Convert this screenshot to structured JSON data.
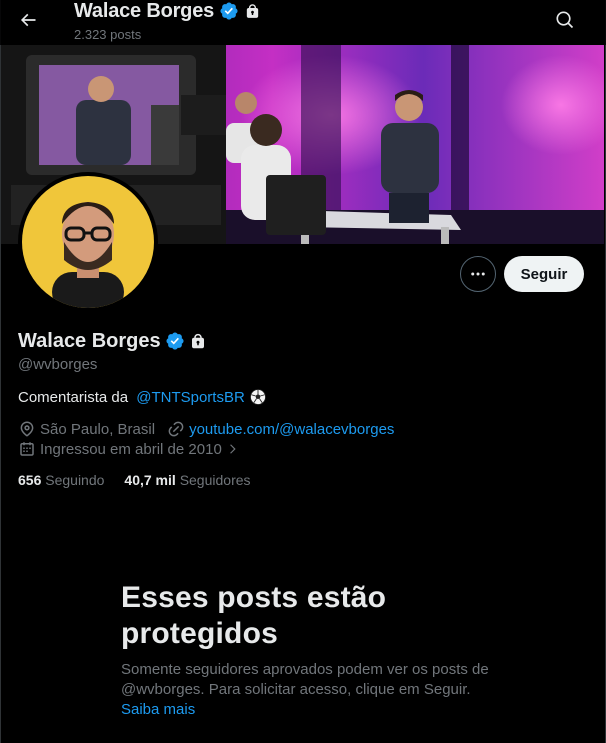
{
  "header": {
    "name": "Walace Borges",
    "posts_count": "2.323 posts"
  },
  "profile": {
    "display_name": "Walace Borges",
    "handle": "@wvborges",
    "verified": true,
    "protected": true,
    "follow_label": "Seguir",
    "bio_prefix": "Comentarista da ",
    "bio_mention": "@TNTSportsBR",
    "location": "São Paulo, Brasil",
    "website": "youtube.com/@walacevborges",
    "joined": "Ingressou em abril de 2010",
    "following_count": "656",
    "following_label": "Seguindo",
    "followers_count": "40,7 mil",
    "followers_label": "Seguidores"
  },
  "protected_notice": {
    "title": "Esses posts estão protegidos",
    "body": "Somente seguidores aprovados podem ver os posts de @wvborges. Para solicitar acesso, clique em Seguir. ",
    "link": "Saiba mais"
  },
  "colors": {
    "background": "#000000",
    "text": "#e7e9ea",
    "muted": "#71767b",
    "link": "#1d9bf0",
    "verified": "#1d9bf0",
    "follow_button": "#eff3f4"
  },
  "icons": [
    "back-arrow-icon",
    "verified-badge-icon",
    "lock-icon",
    "search-icon",
    "more-icon",
    "soccer-ball-icon",
    "location-icon",
    "link-icon",
    "calendar-icon",
    "chevron-right-icon"
  ]
}
